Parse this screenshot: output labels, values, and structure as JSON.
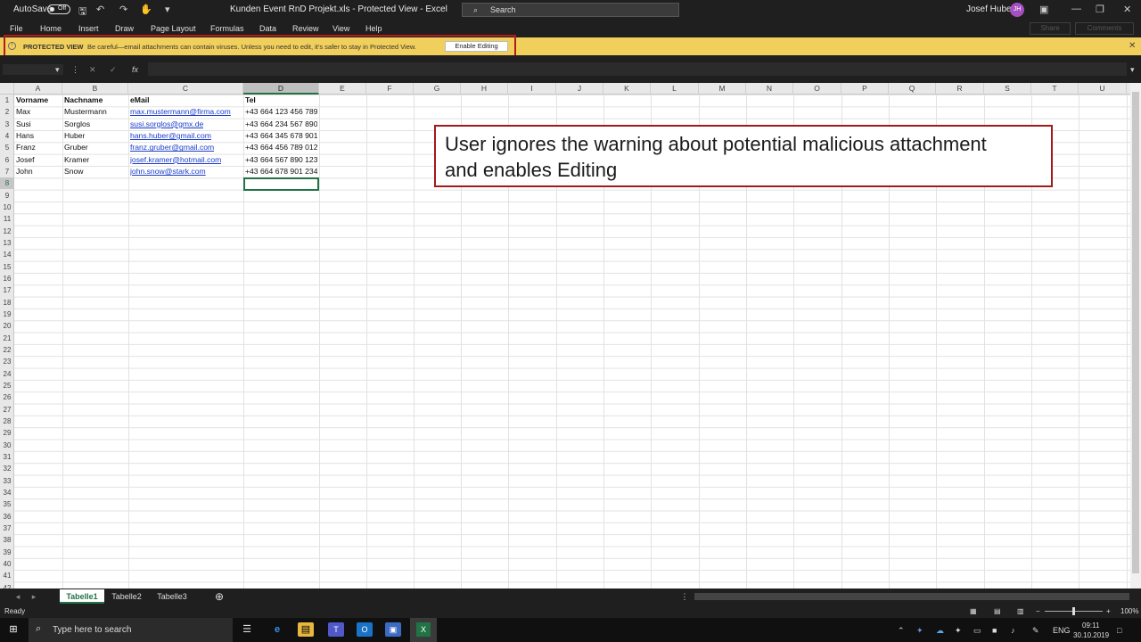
{
  "titlebar": {
    "autosave_label": "AutoSave",
    "autosave_state": "Off",
    "doc_title": "Kunden Event RnD Projekt.xls  -  Protected View  -  Excel",
    "search_placeholder": "Search",
    "user_name": "Josef Huber",
    "user_initials": "JH"
  },
  "ribbon": {
    "tabs": [
      "File",
      "Home",
      "Insert",
      "Draw",
      "Page Layout",
      "Formulas",
      "Data",
      "Review",
      "View",
      "Help"
    ],
    "share_label": "Share",
    "comments_label": "Comments"
  },
  "protected_view": {
    "title": "PROTECTED VIEW",
    "message": "Be careful—email attachments can contain viruses. Unless you need to edit, it's safer to stay in Protected View.",
    "button_label": "Enable Editing"
  },
  "formula_bar": {
    "fx": "fx",
    "value": ""
  },
  "columns": [
    "A",
    "B",
    "C",
    "D",
    "E",
    "F",
    "G",
    "H",
    "I",
    "J",
    "K",
    "L",
    "M",
    "N",
    "O",
    "P",
    "Q",
    "R",
    "S",
    "T",
    "U"
  ],
  "selected_column": "D",
  "rows": [
    "1",
    "2",
    "3",
    "4",
    "5",
    "6",
    "7",
    "8",
    "9",
    "10",
    "11",
    "12",
    "13",
    "14",
    "15",
    "16",
    "17",
    "18",
    "19",
    "20",
    "21",
    "22",
    "23",
    "24",
    "25",
    "26",
    "27",
    "28",
    "29",
    "30",
    "31",
    "32",
    "33",
    "34",
    "35",
    "36",
    "37",
    "38",
    "39",
    "40",
    "41",
    "42"
  ],
  "table": {
    "headers": [
      "Vorname",
      "Nachname",
      "eMail",
      "Tel"
    ],
    "data": [
      [
        "Max",
        "Mustermann",
        "max.mustermann@firma.com",
        "+43 664 123 456 789"
      ],
      [
        "Susi",
        "Sorglos",
        "susi.sorglos@gmx.de",
        "+43 664 234 567 890"
      ],
      [
        "Hans",
        "Huber",
        "hans.huber@gmail.com",
        "+43 664 345 678 901"
      ],
      [
        "Franz",
        "Gruber",
        "franz.gruber@gmail.com",
        "+43 664 456 789 012"
      ],
      [
        "Josef",
        "Kramer",
        "josef.kramer@hotmail.com",
        "+43 664 567 890 123"
      ],
      [
        "John",
        "Snow",
        "john.snow@stark.com",
        "+43 664 678 901 234"
      ]
    ]
  },
  "callout": {
    "line1": "User ignores the warning about potential malicious attachment",
    "line2": "and enables Editing"
  },
  "sheets": [
    "Tabelle1",
    "Tabelle2",
    "Tabelle3"
  ],
  "active_sheet": "Tabelle1",
  "status": {
    "text": "Ready",
    "zoom": "100%"
  },
  "taskbar": {
    "search_placeholder": "Type here to search",
    "language": "ENG",
    "time": "09:11",
    "date": "30.10.2019"
  },
  "colors": {
    "excel_green": "#217346",
    "warning_yellow": "#f1cf5d",
    "callout_red": "#a11b1b"
  }
}
